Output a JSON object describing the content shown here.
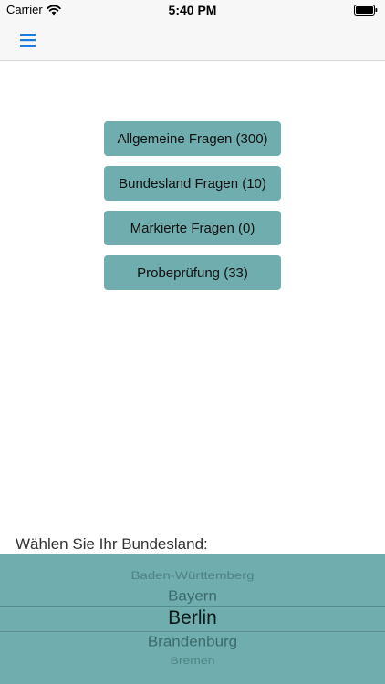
{
  "status_bar": {
    "carrier": "Carrier",
    "time": "5:40 PM",
    "icons": [
      "wifi-icon",
      "battery-icon"
    ]
  },
  "nav_bar": {
    "menu_icon": "hamburger-menu-icon",
    "accent_color": "#1a7fdc"
  },
  "categories": [
    {
      "label": "Allgemeine Fragen (300)"
    },
    {
      "label": "Bundesland Fragen (10)"
    },
    {
      "label": "Markierte Fragen (0)"
    },
    {
      "label": "Probeprüfung (33)"
    }
  ],
  "state_selector": {
    "prompt": "Wählen Sie Ihr Bundesland:",
    "items": [
      "Baden-Württemberg",
      "Bayern",
      "Berlin",
      "Brandenburg",
      "Bremen"
    ],
    "selected": "Berlin"
  },
  "colors": {
    "button_background": "#6fadae",
    "picker_background": "#6fadae",
    "nav_background": "#f7f7f7"
  }
}
